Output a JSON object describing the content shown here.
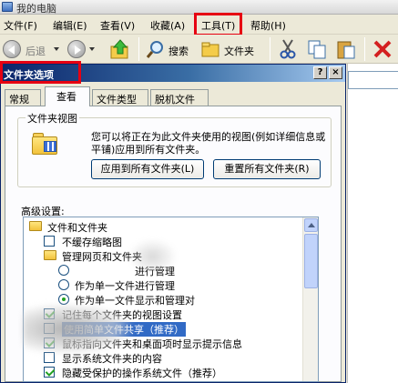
{
  "window": {
    "title": "我的电脑"
  },
  "menubar": {
    "items": [
      "文件(F)",
      "编辑(E)",
      "查看(V)",
      "收藏(A)",
      "工具(T)",
      "帮助(H)"
    ]
  },
  "toolbar": {
    "back_label": "后退",
    "search_label": "搜索",
    "folders_label": "文件夹"
  },
  "dialog": {
    "title": "文件夹选项",
    "help_glyph": "?",
    "close_glyph": "×",
    "tabs": [
      "常规",
      "查看",
      "文件类型",
      "脱机文件"
    ],
    "active_tab": "查看",
    "folder_views": {
      "title": "文件夹视图",
      "description": "您可以将正在为此文件夹使用的视图(例如详细信息或平铺)应用到所有文件夹。",
      "apply_all_button": "应用到所有文件夹(L)",
      "reset_all_button": "重置所有文件夹(R)"
    },
    "advanced": {
      "label": "高级设置:",
      "items": [
        {
          "type": "folder",
          "label": "文件和文件夹"
        },
        {
          "type": "checkbox",
          "checked": false,
          "label": "不缓存缩略图"
        },
        {
          "type": "folder",
          "label": "管理网页和文件夹"
        },
        {
          "type": "radio",
          "selected": false,
          "label": "进行管理"
        },
        {
          "type": "radio",
          "selected": false,
          "label": "作为单一文件进行管理"
        },
        {
          "type": "radio",
          "selected": true,
          "label": "作为单一文件显示和管理对"
        },
        {
          "type": "checkbox",
          "checked": true,
          "label": "记住每个文件夹的视图设置"
        },
        {
          "type": "checkbox",
          "checked": false,
          "label": "使用简单文件共享（推荐）"
        },
        {
          "type": "checkbox",
          "checked": true,
          "label": "鼠标指向文件夹和桌面项时显示提示信息"
        },
        {
          "type": "checkbox",
          "checked": false,
          "label": "显示系统文件夹的内容"
        },
        {
          "type": "checkbox",
          "checked": true,
          "label": "隐藏受保护的操作系统文件（推荐）"
        }
      ]
    }
  },
  "colors": {
    "highlight": "#e60012",
    "selection": "#316ac5",
    "title_bar": "#0a246a"
  }
}
